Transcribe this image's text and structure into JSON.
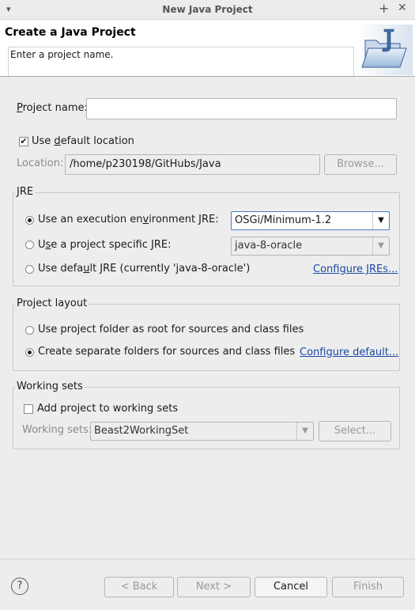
{
  "window": {
    "title": "New Java Project",
    "menu_glyph": "▾",
    "plus_glyph": "+",
    "close_glyph": "✕"
  },
  "header": {
    "title": "Create a Java Project",
    "message": "Enter a project name."
  },
  "project_name": {
    "label_prefix": "",
    "label_mnemonic": "P",
    "label_rest": "roject name:",
    "value": ""
  },
  "default_location": {
    "checked_glyph": "✔",
    "label_pre": "Use ",
    "label_mnemonic": "d",
    "label_post": "efault location"
  },
  "location": {
    "label": "Location:",
    "value": "/home/p230198/GitHubs/Java",
    "browse_label": "Browse..."
  },
  "jre": {
    "legend": "JRE",
    "option_env_pre": "Use an execution en",
    "option_env_mn": "v",
    "option_env_post": "ironment JRE:",
    "env_value": "OSGi/Minimum-1.2",
    "option_specific_pre": "U",
    "option_specific_mn": "s",
    "option_specific_post": "e a project specific JRE:",
    "specific_value": "java-8-oracle",
    "option_default_pre": "Use defa",
    "option_default_mn": "u",
    "option_default_post": "lt JRE (currently 'java-8-oracle')",
    "configure_link": "Configure JREs...",
    "selected": "env"
  },
  "layout": {
    "legend": "Project layout",
    "option_root": "Use project folder as root for sources and class files",
    "option_separate": "Create separate folders for sources and class files",
    "configure_link": "Configure default...",
    "selected": "separate"
  },
  "working_sets": {
    "legend": "Working sets",
    "add_label": "Add project to working sets",
    "sets_label": "Working sets:",
    "sets_value": "Beast2WorkingSet",
    "select_label": "Select..."
  },
  "footer": {
    "help_glyph": "?",
    "back_label": "< Back",
    "next_label": "Next >",
    "cancel_label": "Cancel",
    "finish_label": "Finish"
  },
  "colors": {
    "link": "#1c4aa5",
    "focus": "#4a7bc7"
  }
}
